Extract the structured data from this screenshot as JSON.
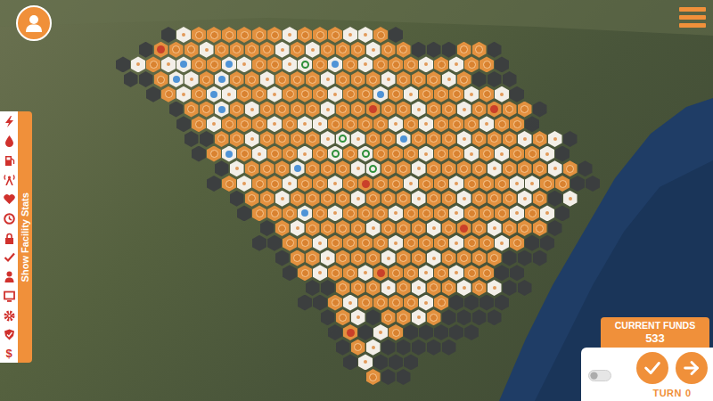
{
  "sidebar": {
    "tab_label": "Show Facility Stats",
    "dollar_glyph": "$"
  },
  "map": {
    "rows": [
      [
        "x",
        "x",
        "x",
        "d",
        "w",
        "o",
        "o",
        "o",
        "o",
        "o",
        "o",
        "w",
        "o",
        "o",
        "o",
        "w",
        "w",
        "o",
        "d"
      ],
      [
        "x",
        "d",
        "r",
        "o",
        "o",
        "w",
        "o",
        "o",
        "o",
        "o",
        "w",
        "o",
        "w",
        "o",
        "o",
        "o",
        "w",
        "o",
        "o",
        "d",
        "d",
        "d",
        "o",
        "o",
        "d"
      ],
      [
        "d",
        "w",
        "o",
        "w",
        "b",
        "o",
        "o",
        "b",
        "w",
        "o",
        "o",
        "w",
        "g",
        "o",
        "b",
        "o",
        "w",
        "o",
        "o",
        "o",
        "w",
        "o",
        "w",
        "o",
        "o",
        "d"
      ],
      [
        "d",
        "d",
        "o",
        "b",
        "w",
        "o",
        "b",
        "o",
        "o",
        "w",
        "o",
        "o",
        "o",
        "w",
        "o",
        "o",
        "o",
        "w",
        "o",
        "o",
        "o",
        "w",
        "o",
        "d",
        "d",
        "d"
      ],
      [
        "x",
        "x",
        "d",
        "o",
        "w",
        "o",
        "b",
        "w",
        "o",
        "o",
        "w",
        "o",
        "o",
        "o",
        "w",
        "o",
        "o",
        "b",
        "o",
        "w",
        "o",
        "o",
        "o",
        "w",
        "o",
        "w",
        "d"
      ],
      [
        "x",
        "x",
        "x",
        "d",
        "o",
        "o",
        "b",
        "o",
        "w",
        "o",
        "o",
        "o",
        "o",
        "w",
        "o",
        "o",
        "r",
        "o",
        "o",
        "w",
        "o",
        "o",
        "w",
        "o",
        "r",
        "o",
        "o",
        "d"
      ],
      [
        "x",
        "x",
        "x",
        "x",
        "d",
        "o",
        "w",
        "o",
        "o",
        "o",
        "w",
        "o",
        "w",
        "w",
        "o",
        "o",
        "o",
        "o",
        "w",
        "o",
        "w",
        "o",
        "o",
        "o",
        "w",
        "o",
        "o",
        "d"
      ],
      [
        "x",
        "x",
        "x",
        "x",
        "d",
        "d",
        "o",
        "o",
        "w",
        "o",
        "o",
        "o",
        "o",
        "w",
        "g",
        "w",
        "o",
        "o",
        "b",
        "o",
        "o",
        "o",
        "w",
        "o",
        "o",
        "o",
        "w",
        "o",
        "w",
        "d"
      ],
      [
        "x",
        "x",
        "x",
        "x",
        "x",
        "d",
        "o",
        "b",
        "o",
        "w",
        "o",
        "o",
        "w",
        "o",
        "g",
        "o",
        "g",
        "o",
        "o",
        "o",
        "w",
        "o",
        "o",
        "w",
        "o",
        "w",
        "o",
        "o",
        "w",
        "d"
      ],
      [
        "x",
        "x",
        "x",
        "x",
        "x",
        "x",
        "d",
        "w",
        "o",
        "o",
        "o",
        "b",
        "o",
        "o",
        "o",
        "w",
        "g",
        "o",
        "o",
        "w",
        "o",
        "o",
        "o",
        "o",
        "w",
        "o",
        "o",
        "o",
        "w",
        "o",
        "d"
      ],
      [
        "x",
        "x",
        "x",
        "x",
        "x",
        "x",
        "d",
        "o",
        "w",
        "o",
        "o",
        "w",
        "o",
        "o",
        "w",
        "o",
        "r",
        "o",
        "o",
        "w",
        "o",
        "o",
        "w",
        "o",
        "o",
        "o",
        "w",
        "w",
        "o",
        "o",
        "d",
        "d"
      ],
      [
        "x",
        "x",
        "x",
        "x",
        "x",
        "x",
        "x",
        "d",
        "o",
        "o",
        "w",
        "o",
        "o",
        "o",
        "o",
        "w",
        "o",
        "o",
        "o",
        "w",
        "o",
        "o",
        "w",
        "o",
        "o",
        "o",
        "w",
        "o",
        "d",
        "w"
      ],
      [
        "x",
        "x",
        "x",
        "x",
        "x",
        "x",
        "x",
        "x",
        "d",
        "o",
        "o",
        "o",
        "b",
        "o",
        "w",
        "o",
        "o",
        "o",
        "w",
        "o",
        "o",
        "o",
        "w",
        "o",
        "o",
        "o",
        "w",
        "o",
        "w",
        "d"
      ],
      [
        "x",
        "x",
        "x",
        "x",
        "x",
        "x",
        "x",
        "x",
        "x",
        "d",
        "o",
        "w",
        "o",
        "o",
        "o",
        "o",
        "w",
        "o",
        "o",
        "o",
        "w",
        "o",
        "r",
        "o",
        "w",
        "o",
        "o",
        "o",
        "d"
      ],
      [
        "x",
        "x",
        "x",
        "x",
        "x",
        "x",
        "x",
        "x",
        "x",
        "d",
        "d",
        "o",
        "o",
        "w",
        "o",
        "o",
        "o",
        "o",
        "w",
        "o",
        "o",
        "o",
        "w",
        "o",
        "o",
        "w",
        "o",
        "d",
        "d"
      ],
      [
        "x",
        "x",
        "x",
        "x",
        "x",
        "x",
        "x",
        "x",
        "x",
        "x",
        "d",
        "o",
        "o",
        "w",
        "o",
        "o",
        "o",
        "w",
        "o",
        "o",
        "w",
        "o",
        "o",
        "o",
        "o",
        "d",
        "d",
        "d"
      ],
      [
        "x",
        "x",
        "x",
        "x",
        "x",
        "x",
        "x",
        "x",
        "x",
        "x",
        "x",
        "d",
        "o",
        "w",
        "o",
        "o",
        "w",
        "r",
        "o",
        "o",
        "w",
        "o",
        "w",
        "o",
        "o",
        "d",
        "d"
      ],
      [
        "x",
        "x",
        "x",
        "x",
        "x",
        "x",
        "x",
        "x",
        "x",
        "x",
        "x",
        "x",
        "d",
        "d",
        "o",
        "o",
        "o",
        "w",
        "o",
        "w",
        "o",
        "o",
        "w",
        "o",
        "w",
        "d",
        "d"
      ],
      [
        "x",
        "x",
        "x",
        "x",
        "x",
        "x",
        "x",
        "x",
        "x",
        "x",
        "x",
        "x",
        "d",
        "d",
        "o",
        "w",
        "o",
        "o",
        "o",
        "o",
        "w",
        "o",
        "d",
        "d",
        "d",
        "d"
      ],
      [
        "x",
        "x",
        "x",
        "x",
        "x",
        "x",
        "x",
        "x",
        "x",
        "x",
        "x",
        "x",
        "x",
        "d",
        "o",
        "w",
        "d",
        "o",
        "o",
        "w",
        "o",
        "d",
        "d",
        "d",
        "d"
      ],
      [
        "x",
        "x",
        "x",
        "x",
        "x",
        "x",
        "x",
        "x",
        "x",
        "x",
        "x",
        "x",
        "x",
        "x",
        "d",
        "r",
        "d",
        "w",
        "o",
        "d",
        "d",
        "d",
        "d",
        "d"
      ],
      [
        "x",
        "x",
        "x",
        "x",
        "x",
        "x",
        "x",
        "x",
        "x",
        "x",
        "x",
        "x",
        "x",
        "x",
        "d",
        "o",
        "w",
        "d",
        "d",
        "d",
        "d",
        "d"
      ],
      [
        "x",
        "x",
        "x",
        "x",
        "x",
        "x",
        "x",
        "x",
        "x",
        "x",
        "x",
        "x",
        "x",
        "x",
        "x",
        "d",
        "w",
        "d",
        "d",
        "d"
      ],
      [
        "x",
        "x",
        "x",
        "x",
        "x",
        "x",
        "x",
        "x",
        "x",
        "x",
        "x",
        "x",
        "x",
        "x",
        "x",
        "x",
        "o",
        "d",
        "d"
      ]
    ]
  },
  "funds": {
    "label": "CURRENT FUNDS",
    "value": "533"
  },
  "controls": {
    "auto_toggle": {
      "on": false
    }
  },
  "turn": {
    "label": "TURN",
    "value": "0"
  }
}
